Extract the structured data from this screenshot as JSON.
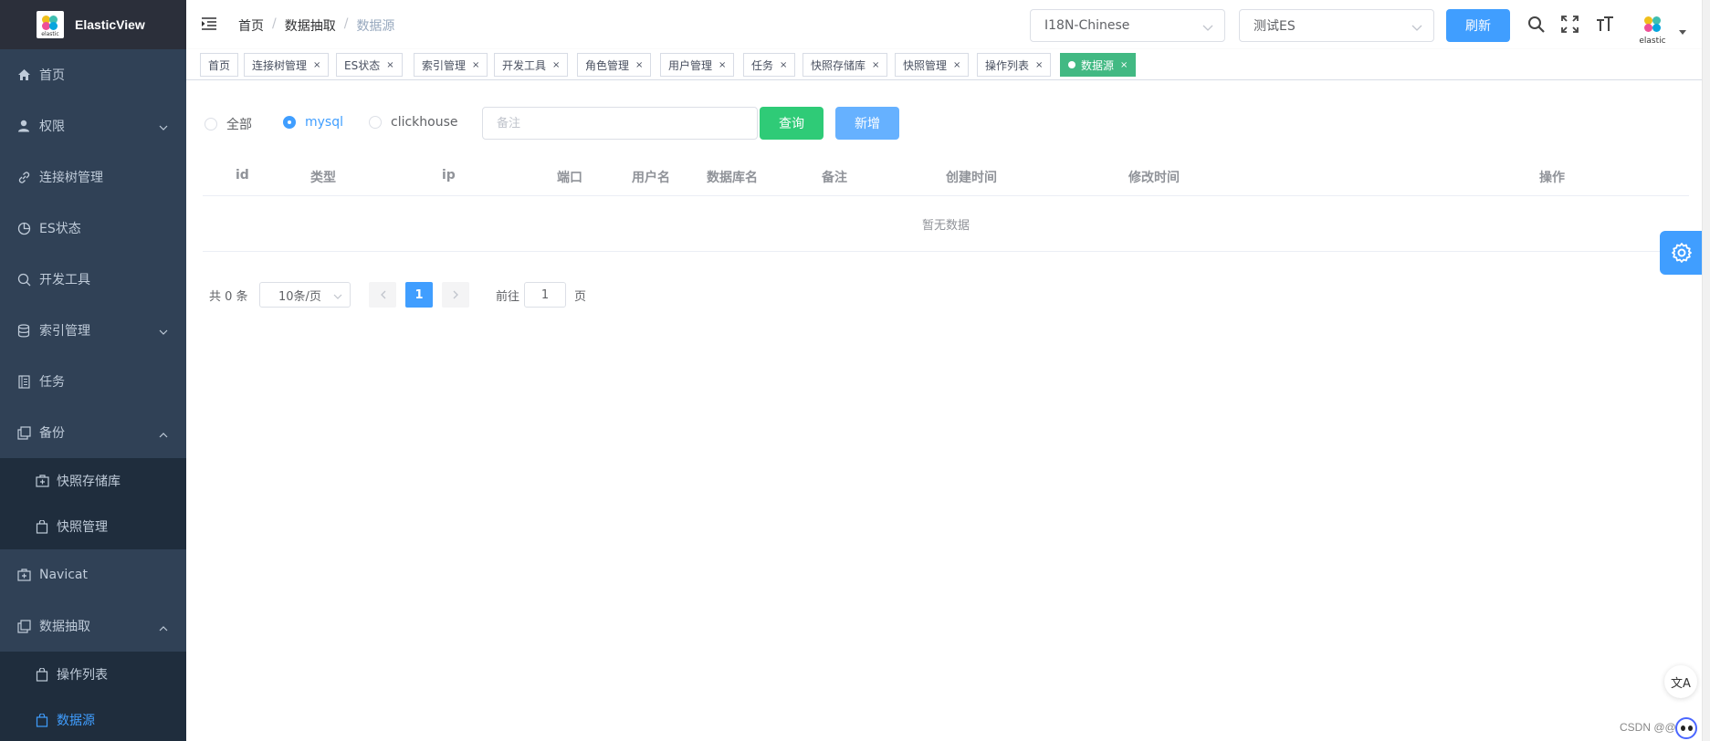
{
  "app": {
    "logo_caption": "elastic",
    "title": "ElasticView"
  },
  "sidebar": {
    "items": [
      {
        "label": "首页",
        "icon": "home-icon"
      },
      {
        "label": "权限",
        "icon": "user-icon",
        "expandable": true
      },
      {
        "label": "连接树管理",
        "icon": "link-icon"
      },
      {
        "label": "ES状态",
        "icon": "pie-chart-icon"
      },
      {
        "label": "开发工具",
        "icon": "search-icon"
      },
      {
        "label": "索引管理",
        "icon": "database-icon",
        "expandable": true
      },
      {
        "label": "任务",
        "icon": "document-icon"
      },
      {
        "label": "备份",
        "icon": "copy-icon",
        "expanded": true
      },
      {
        "label": "Navicat",
        "icon": "first-aid-icon"
      },
      {
        "label": "数据抽取",
        "icon": "copy-icon",
        "expanded": true
      }
    ],
    "backup_children": [
      "快照存储库",
      "快照管理"
    ],
    "extract_children": [
      "操作列表",
      "数据源"
    ],
    "active_item": "数据源"
  },
  "header": {
    "breadcrumb": [
      "首页",
      "数据抽取",
      "数据源"
    ],
    "language_select": "I18N-Chinese",
    "connection_select": "测试ES",
    "refresh_label": "刷新",
    "avatar_caption": "elastic"
  },
  "tags": [
    {
      "label": "首页",
      "closable": false
    },
    {
      "label": "连接树管理",
      "closable": true
    },
    {
      "label": "ES状态",
      "closable": true
    },
    {
      "label": "索引管理",
      "closable": true
    },
    {
      "label": "开发工具",
      "closable": true
    },
    {
      "label": "角色管理",
      "closable": true
    },
    {
      "label": "用户管理",
      "closable": true
    },
    {
      "label": "任务",
      "closable": true
    },
    {
      "label": "快照存储库",
      "closable": true
    },
    {
      "label": "快照管理",
      "closable": true
    },
    {
      "label": "操作列表",
      "closable": true
    },
    {
      "label": "数据源",
      "closable": true,
      "active": true
    }
  ],
  "filters": {
    "radio_all": "全部",
    "radio_mysql": "mysql",
    "radio_clickhouse": "clickhouse",
    "selected": "mysql",
    "note_placeholder": "备注",
    "query_label": "查询",
    "add_label": "新增"
  },
  "table": {
    "columns": [
      "id",
      "类型",
      "ip",
      "端口",
      "用户名",
      "数据库名",
      "备注",
      "创建时间",
      "修改时间",
      "操作"
    ],
    "empty_text": "暂无数据"
  },
  "pagination": {
    "total_text": "共 0 条",
    "page_size": "10条/页",
    "current_page": "1",
    "goto_prefix": "前往",
    "goto_value": "1",
    "goto_suffix": "页"
  },
  "floating": {
    "translate_label": "文A",
    "watermark": "CSDN @@"
  },
  "colors": {
    "sidebar_bg": "#304156",
    "logo_bg": "#2b2f3a",
    "submenu_bg": "#1f2d3d",
    "primary": "#409eff",
    "success": "#2fcb77",
    "active_tag": "#42b983"
  }
}
